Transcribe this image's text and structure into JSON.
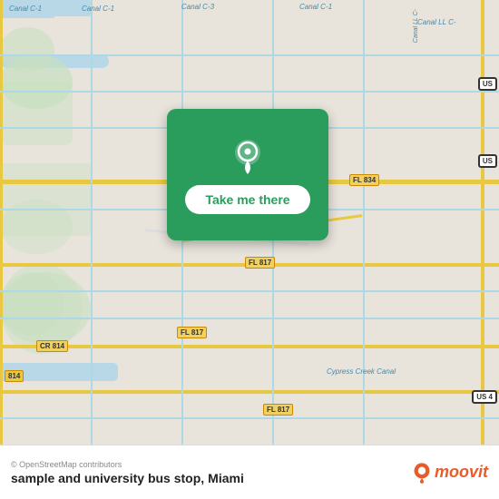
{
  "map": {
    "attribution": "© OpenStreetMap contributors",
    "background_color": "#e8e4dc"
  },
  "popup": {
    "button_label": "Take me there"
  },
  "bottom_bar": {
    "stop_name": "sample and university bus stop,",
    "city": "Miami",
    "moovit_text": "moovit"
  },
  "road_labels": {
    "fl834": "FL 834",
    "fl817_1": "FL 817",
    "fl817_2": "FL 817",
    "fl817_3": "FL 817",
    "cr814": "CR 814",
    "r814": "814",
    "us_shield": "US",
    "cypress_creek": "Cypress Creek Canal"
  },
  "canal_labels": {
    "canal_c1_top": "Canal C-1",
    "canal_c1_left": "Canal C-1",
    "canal_c3_top": "Canal C-3",
    "canal_c1_right": "Canal C-1",
    "canal_ll_c": "Canal LL C-"
  }
}
